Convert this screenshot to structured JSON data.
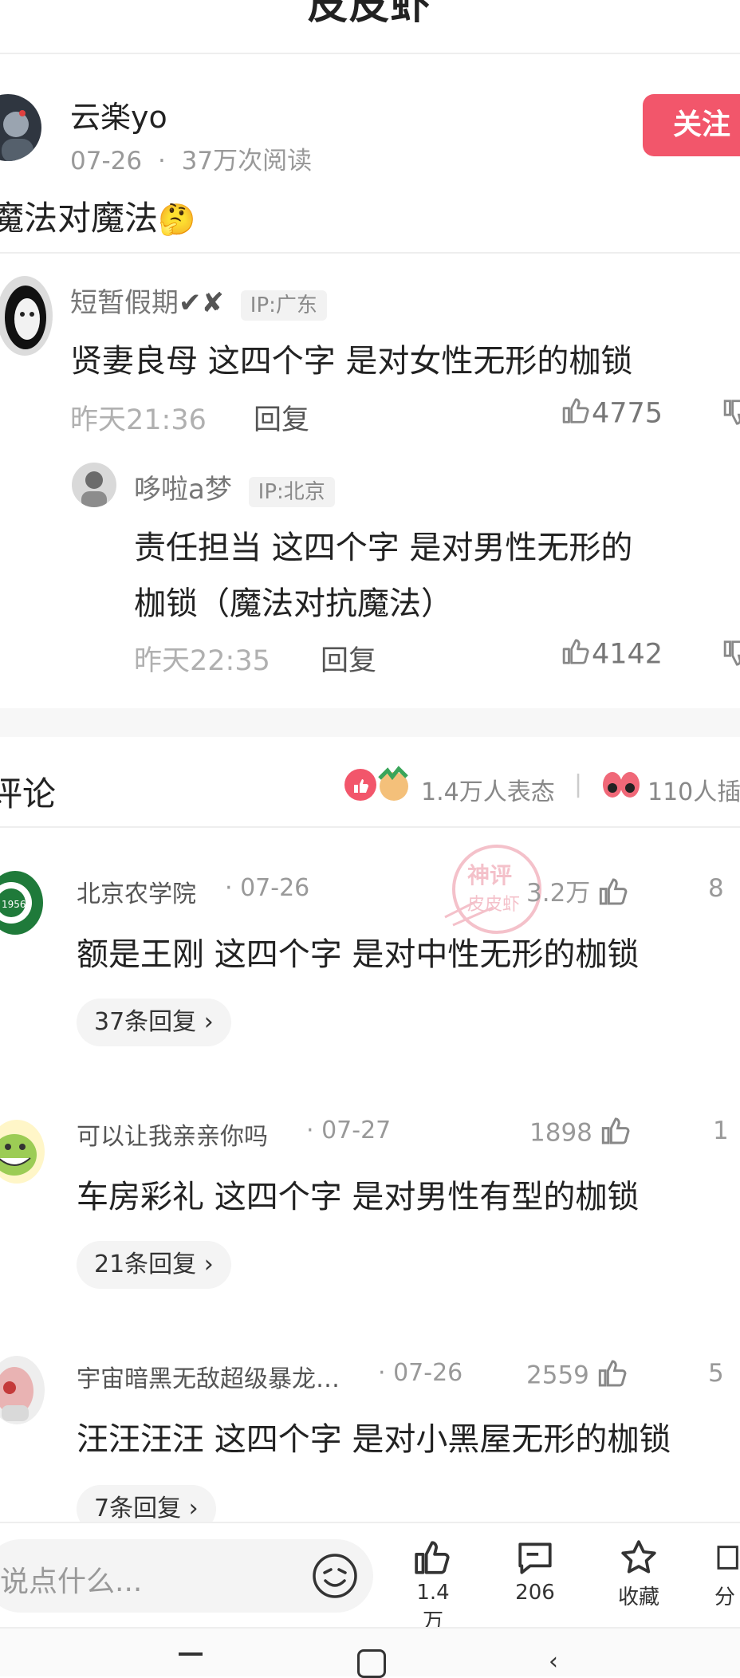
{
  "header": {
    "title": "皮皮虾"
  },
  "post": {
    "author": "云楽yo",
    "date": "07-26",
    "separator": "·",
    "reads": "37万次阅读",
    "follow_label": "关注",
    "title": "魔法对魔法",
    "title_emoji": "🤔"
  },
  "quoted": {
    "comment": {
      "user": "短暂假期",
      "user_suffix": "✔✘",
      "ip": "IP:广东",
      "text": "贤妻良母  这四个字  是对女性无形的枷锁",
      "time": "昨天21:36",
      "reply_label": "回复",
      "likes": "4775"
    },
    "reply": {
      "user": "哆啦a梦",
      "ip": "IP:北京",
      "text_line1": "责任担当  这四个字  是对男性无形的",
      "text_line2": "枷锁（魔法对抗魔法）",
      "time": "昨天22:35",
      "reply_label": "回复",
      "likes": "4142"
    }
  },
  "comments_section": {
    "title": "评论",
    "reactions": "1.4万人表态",
    "divider": "|",
    "inserts": "110人插"
  },
  "comments": [
    {
      "user": "北京农学院",
      "date": "· 07-26",
      "likes": "3.2万",
      "extra": "8",
      "text": "额是王刚  这四个字  是对中性无形的枷锁",
      "replies": "37条回复 ›"
    },
    {
      "user": "可以让我亲亲你吗",
      "date": "· 07-27",
      "likes": "1898",
      "extra": "1",
      "text": "车房彩礼  这四个字  是对男性有型的枷锁",
      "replies": "21条回复 ›"
    },
    {
      "user": "宇宙暗黑无敌超级暴龙…",
      "date": "· 07-26",
      "likes": "2559",
      "extra": "5",
      "text": "汪汪汪汪  这四个字  是对小黑屋无形的枷锁",
      "replies": "7条回复 ›"
    }
  ],
  "bottom_bar": {
    "input_placeholder": "说点什么...",
    "like_count": "1.4万",
    "comment_count": "206",
    "favorite_label": "收藏",
    "share_label": "分"
  },
  "watermark": {
    "line1": "神评",
    "line2": "皮皮虾"
  },
  "colors": {
    "accent": "#f2566b",
    "gray_text": "#999999",
    "pill_bg": "#f4f4f4"
  }
}
